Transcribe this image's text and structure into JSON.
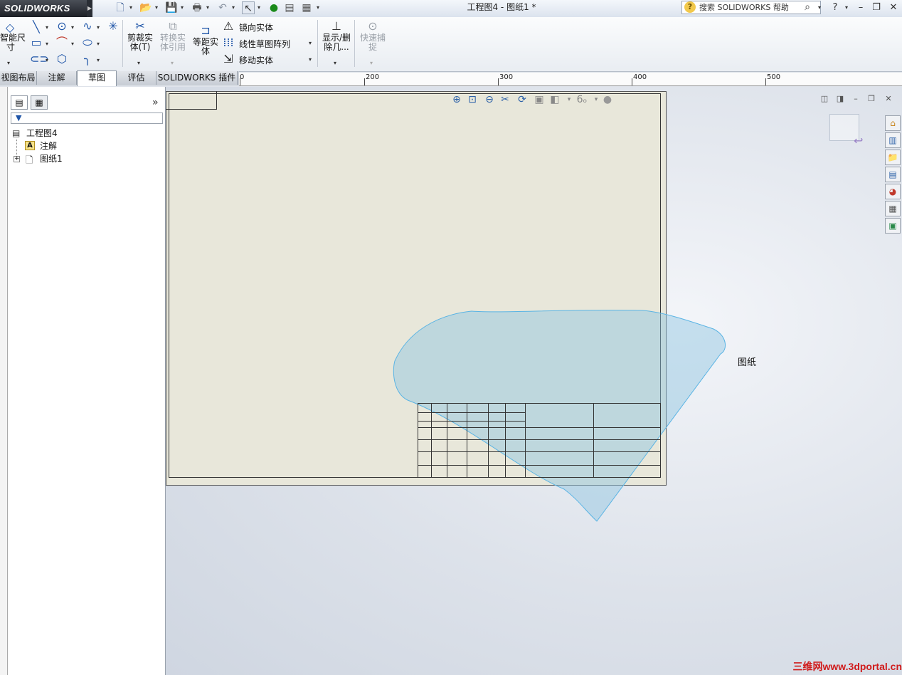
{
  "app": {
    "logo": "SOLIDWORKS",
    "doc_title": "工程图4 - 图纸1 *"
  },
  "search": {
    "placeholder": "搜索 SOLIDWORKS 帮助"
  },
  "ribbon": {
    "smart_dim": "智能尺\n寸",
    "trim": "剪裁实\n体(T)",
    "convert": "转换实\n体引用",
    "offset": "等距实\n体",
    "mirror": "镜向实体",
    "linear_pattern": "线性草图阵列",
    "move": "移动实体",
    "show_delete": "显示/删\n除几...",
    "quick_snap": "快速捕\n捉"
  },
  "tabs": [
    {
      "label": "视图布局"
    },
    {
      "label": "注解"
    },
    {
      "label": "草图"
    },
    {
      "label": "评估"
    },
    {
      "label": "SOLIDWORKS 插件"
    }
  ],
  "ruler": {
    "labels": [
      "0",
      "200",
      "300",
      "400",
      "500"
    ]
  },
  "tree": {
    "root": "工程图4",
    "items": [
      "注解",
      "图纸1"
    ]
  },
  "sheet": {
    "label": "图纸"
  },
  "watermark": "三维网www.3dportal.cn"
}
